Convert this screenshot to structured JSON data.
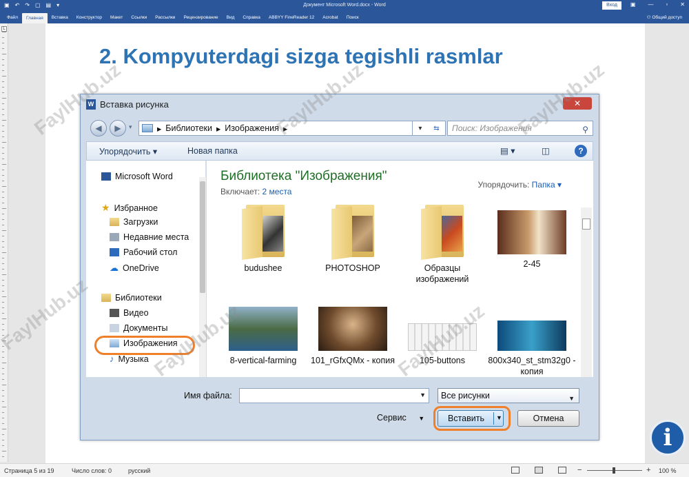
{
  "word": {
    "doc_title": "Документ Microsoft Word.docx  -  Word",
    "signin": "Вход",
    "share": "Общий доступ",
    "tabs": [
      "Файл",
      "Главная",
      "Вставка",
      "Конструктор",
      "Макет",
      "Ссылки",
      "Рассылки",
      "Рецензирование",
      "Вид",
      "Справка",
      "ABBYY FineReader 12",
      "Acrobat",
      "Поиск"
    ],
    "active_tab": "Главная"
  },
  "slide": {
    "title": "2. Kompyuterdagi sizga tegishli rasmlar"
  },
  "dialog": {
    "title": "Вставка рисунка",
    "address": [
      "Библиотеки",
      "Изображения"
    ],
    "search_placeholder": "Поиск: Изображения",
    "toolbar": {
      "organize": "Упорядочить",
      "new_folder": "Новая папка"
    },
    "nav": {
      "app": "Microsoft Word",
      "favorites": "Избранное",
      "favorites_items": [
        "Загрузки",
        "Недавние места",
        "Рабочий стол",
        "OneDrive"
      ],
      "libraries": "Библиотеки",
      "library_items": [
        "Видео",
        "Документы",
        "Изображения",
        "Музыка"
      ],
      "selected": "Изображения"
    },
    "content": {
      "library_title": "Библиотека \"Изображения\"",
      "includes_label": "Включает:",
      "includes_value": "2 места",
      "arrange_label": "Упорядочить:",
      "arrange_value": "Папка",
      "items": [
        {
          "name": "budushee",
          "kind": "folder"
        },
        {
          "name": "PHOTOSHOP",
          "kind": "folder"
        },
        {
          "name": "Образцы изображений",
          "kind": "folder"
        },
        {
          "name": "2-45",
          "kind": "image"
        },
        {
          "name": "8-vertical-farming",
          "kind": "image"
        },
        {
          "name": "101_rGfxQMx - копия",
          "kind": "image"
        },
        {
          "name": "105-buttons",
          "kind": "image"
        },
        {
          "name": "800x340_st_stm32g0 - копия",
          "kind": "image"
        }
      ]
    },
    "footer": {
      "filename_label": "Имя файла:",
      "filename_value": "",
      "filter": "Все рисунки",
      "service": "Сервис",
      "insert": "Вставить",
      "cancel": "Отмена"
    }
  },
  "watermark": "FaylHub.uz",
  "statusbar": {
    "page": "Страница 5 из 19",
    "words": "Число слов: 0",
    "lang": "русский",
    "zoom": "100 %"
  },
  "colors": {
    "word_blue": "#2b579a",
    "title_blue": "#2e74b5",
    "highlight": "#f07f2a",
    "library_green": "#1f6e25"
  }
}
